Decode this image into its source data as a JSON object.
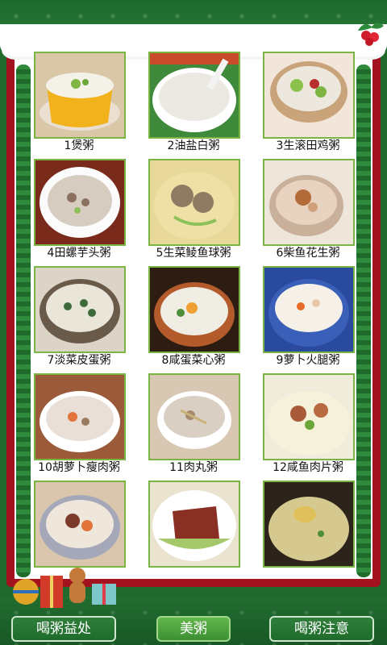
{
  "items": [
    {
      "label": "1煲粥"
    },
    {
      "label": "2油盐白粥"
    },
    {
      "label": "3生滚田鸡粥"
    },
    {
      "label": "4田螺芋头粥"
    },
    {
      "label": "5生菜鲮鱼球粥"
    },
    {
      "label": "6柴鱼花生粥"
    },
    {
      "label": "7淡菜皮蛋粥"
    },
    {
      "label": "8咸蛋菜心粥"
    },
    {
      "label": "9萝卜火腿粥"
    },
    {
      "label": "10胡萝卜瘦肉粥"
    },
    {
      "label": "11肉丸粥"
    },
    {
      "label": "12咸鱼肉片粥"
    },
    {
      "label": ""
    },
    {
      "label": ""
    },
    {
      "label": ""
    }
  ],
  "tabs": {
    "left": "喝粥益处",
    "middle": "美粥",
    "right": "喝粥注意"
  },
  "colors": {
    "frame_green": "#1f6a2c",
    "board_red": "#a3131f",
    "photo_border": "#7ab544",
    "active_tab": "#4f9f3f"
  }
}
